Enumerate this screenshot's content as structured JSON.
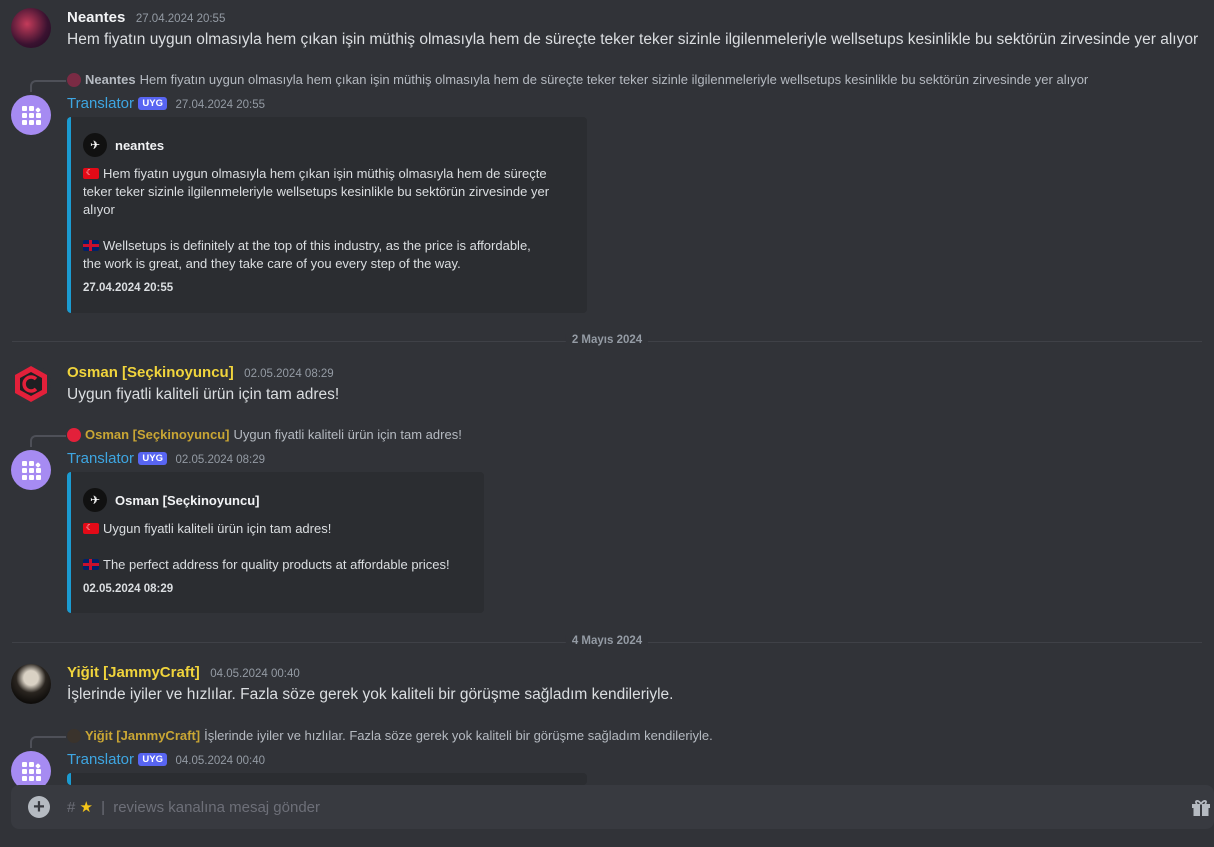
{
  "messages": [
    {
      "user": "Neantes",
      "user_color": "#f2f3f5",
      "time": "27.04.2024 20:55",
      "text": "Hem fiyatın uygun olmasıyla hem çıkan işin müthiş olmasıyla hem de süreçte teker teker sizinle ilgilenmeleriyle wellsetups kesinlikle bu sektörün zirvesinde yer alıyor"
    },
    {
      "reply_user": "Neantes",
      "reply_text": "Hem fiyatın uygun olmasıyla hem çıkan işin müthiş olmasıyla hem de süreçte teker teker sizinle ilgilenmeleriyle wellsetups kesinlikle bu sektörün zirvesinde yer alıyor",
      "user": "Translator",
      "badge": "UYG",
      "time": "27.04.2024 20:55",
      "embed_author": "neantes",
      "embed_tr_lines": [
        "Hem fiyatın uygun olmasıyla hem çıkan işin müthiş olmasıyla hem de süreçte",
        "teker teker sizinle ilgilenmeleriyle wellsetups kesinlikle bu sektörün zirvesinde yer",
        "alıyor"
      ],
      "embed_en_lines": [
        "Wellsetups is definitely at the top of this industry, as the price is affordable,",
        "the work is great, and they take care of you every step of the way."
      ],
      "embed_footer": "27.04.2024 20:55"
    },
    {
      "user": "Osman [Seçkinoyuncu]",
      "user_color": "#f0d43c",
      "time": "02.05.2024 08:29",
      "text": "Uygun fiyatli kaliteli ürün için tam adres!"
    },
    {
      "reply_user": "Osman [Seçkinoyuncu]",
      "reply_text": "Uygun fiyatli kaliteli ürün için tam adres!",
      "user": "Translator",
      "badge": "UYG",
      "time": "02.05.2024 08:29",
      "embed_author": "Osman [Seçkinoyuncu]",
      "embed_tr": "Uygun fiyatli kaliteli ürün için tam adres!",
      "embed_en": "The perfect address for quality products at affordable prices!",
      "embed_footer": "02.05.2024 08:29"
    },
    {
      "user": "Yiğit [JammyCraft]",
      "user_color": "#f0d43c",
      "time": "04.05.2024 00:40",
      "text": "İşlerinde iyiler ve hızlılar. Fazla söze gerek yok kaliteli bir görüşme sağladım kendileriyle."
    },
    {
      "reply_user": "Yiğit [JammyCraft]",
      "reply_text": "İşlerinde iyiler ve hızlılar. Fazla söze gerek yok kaliteli bir görüşme sağladım kendileriyle.",
      "user": "Translator",
      "badge": "UYG",
      "time": "04.05.2024 00:40"
    }
  ],
  "dividers": [
    "2 Mayıs 2024",
    "4 Mayıs 2024"
  ],
  "composer": {
    "prefix": "#",
    "placeholder": "reviews kanalına mesaj gönder"
  },
  "colors": {
    "bot_name": "#3ea6e2",
    "reply_name_gold": "#c9a634",
    "embed_border": "#1b9bd1"
  }
}
